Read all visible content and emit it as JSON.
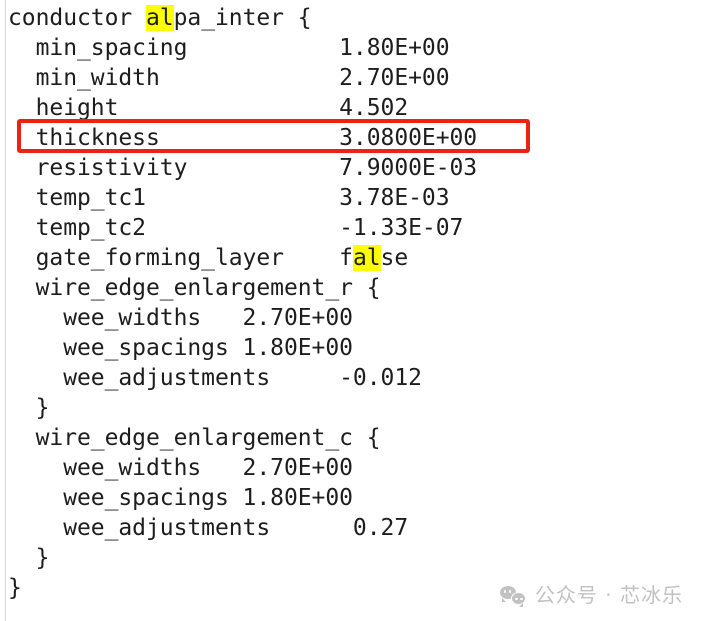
{
  "document": {
    "type": "tech-file-config",
    "background_color": "#ffffff",
    "text_color": "#1d1d1d",
    "highlight_color": "#ffff00",
    "annotation_color": "#ee2211"
  },
  "code": {
    "lines": [
      {
        "indent": 0,
        "segments": [
          {
            "t": "conductor "
          },
          {
            "t": "al",
            "hl": true
          },
          {
            "t": "pa_inter {"
          }
        ]
      },
      {
        "indent": 0,
        "segments": [
          {
            "t": "  min_spacing           1.80E+00"
          }
        ]
      },
      {
        "indent": 0,
        "segments": [
          {
            "t": "  min_width             2.70E+00"
          }
        ]
      },
      {
        "indent": 0,
        "segments": [
          {
            "t": "  height                4.502"
          }
        ]
      },
      {
        "indent": 0,
        "segments": [
          {
            "t": "  thickness             3.0800E+00"
          }
        ]
      },
      {
        "indent": 0,
        "segments": [
          {
            "t": "  resistivity           7.9000E-03"
          }
        ]
      },
      {
        "indent": 0,
        "segments": [
          {
            "t": "  temp_tc1              3.78E-03"
          }
        ]
      },
      {
        "indent": 0,
        "segments": [
          {
            "t": "  temp_tc2              -1.33E-07"
          }
        ]
      },
      {
        "indent": 0,
        "segments": [
          {
            "t": "  gate_forming_layer    f"
          },
          {
            "t": "al",
            "hl": true
          },
          {
            "t": "se"
          }
        ]
      },
      {
        "indent": 0,
        "segments": [
          {
            "t": "  wire_edge_enlargement_r {"
          }
        ]
      },
      {
        "indent": 0,
        "segments": [
          {
            "t": "    wee_widths   2.70E+00"
          }
        ]
      },
      {
        "indent": 0,
        "segments": [
          {
            "t": "    wee_spacings 1.80E+00"
          }
        ]
      },
      {
        "indent": 0,
        "segments": [
          {
            "t": "    wee_adjustments     -0.012"
          }
        ]
      },
      {
        "indent": 0,
        "segments": [
          {
            "t": "  }"
          }
        ]
      },
      {
        "indent": 0,
        "segments": [
          {
            "t": "  wire_edge_enlargement_c {"
          }
        ]
      },
      {
        "indent": 0,
        "segments": [
          {
            "t": "    wee_widths   2.70E+00"
          }
        ]
      },
      {
        "indent": 0,
        "segments": [
          {
            "t": "    wee_spacings 1.80E+00"
          }
        ]
      },
      {
        "indent": 0,
        "segments": [
          {
            "t": "    wee_adjustments      0.27"
          }
        ]
      },
      {
        "indent": 0,
        "segments": [
          {
            "t": "  }"
          }
        ]
      },
      {
        "indent": 0,
        "segments": [
          {
            "t": "}"
          }
        ]
      }
    ],
    "properties": [
      {
        "name": "min_spacing",
        "value": "1.80E+00"
      },
      {
        "name": "min_width",
        "value": "2.70E+00"
      },
      {
        "name": "height",
        "value": "4.502"
      },
      {
        "name": "thickness",
        "value": "3.0800E+00"
      },
      {
        "name": "resistivity",
        "value": "7.9000E-03"
      },
      {
        "name": "temp_tc1",
        "value": "3.78E-03"
      },
      {
        "name": "temp_tc2",
        "value": "-1.33E-07"
      },
      {
        "name": "gate_forming_layer",
        "value": "false"
      }
    ],
    "blocks": [
      {
        "name": "wire_edge_enlargement_r",
        "properties": [
          {
            "name": "wee_widths",
            "value": "2.70E+00"
          },
          {
            "name": "wee_spacings",
            "value": "1.80E+00"
          },
          {
            "name": "wee_adjustments",
            "value": "-0.012"
          }
        ]
      },
      {
        "name": "wire_edge_enlargement_c",
        "properties": [
          {
            "name": "wee_widths",
            "value": "2.70E+00"
          },
          {
            "name": "wee_spacings",
            "value": "1.80E+00"
          },
          {
            "name": "wee_adjustments",
            "value": "0.27"
          }
        ]
      }
    ],
    "root_name": "alpa_inter",
    "root_keyword": "conductor",
    "search_term": "al"
  },
  "annotation": {
    "target_line": "thickness",
    "target_value": "3.0800E+00"
  },
  "watermark": {
    "text": "公众号 · 芯冰乐",
    "icon": "wechat-icon"
  }
}
